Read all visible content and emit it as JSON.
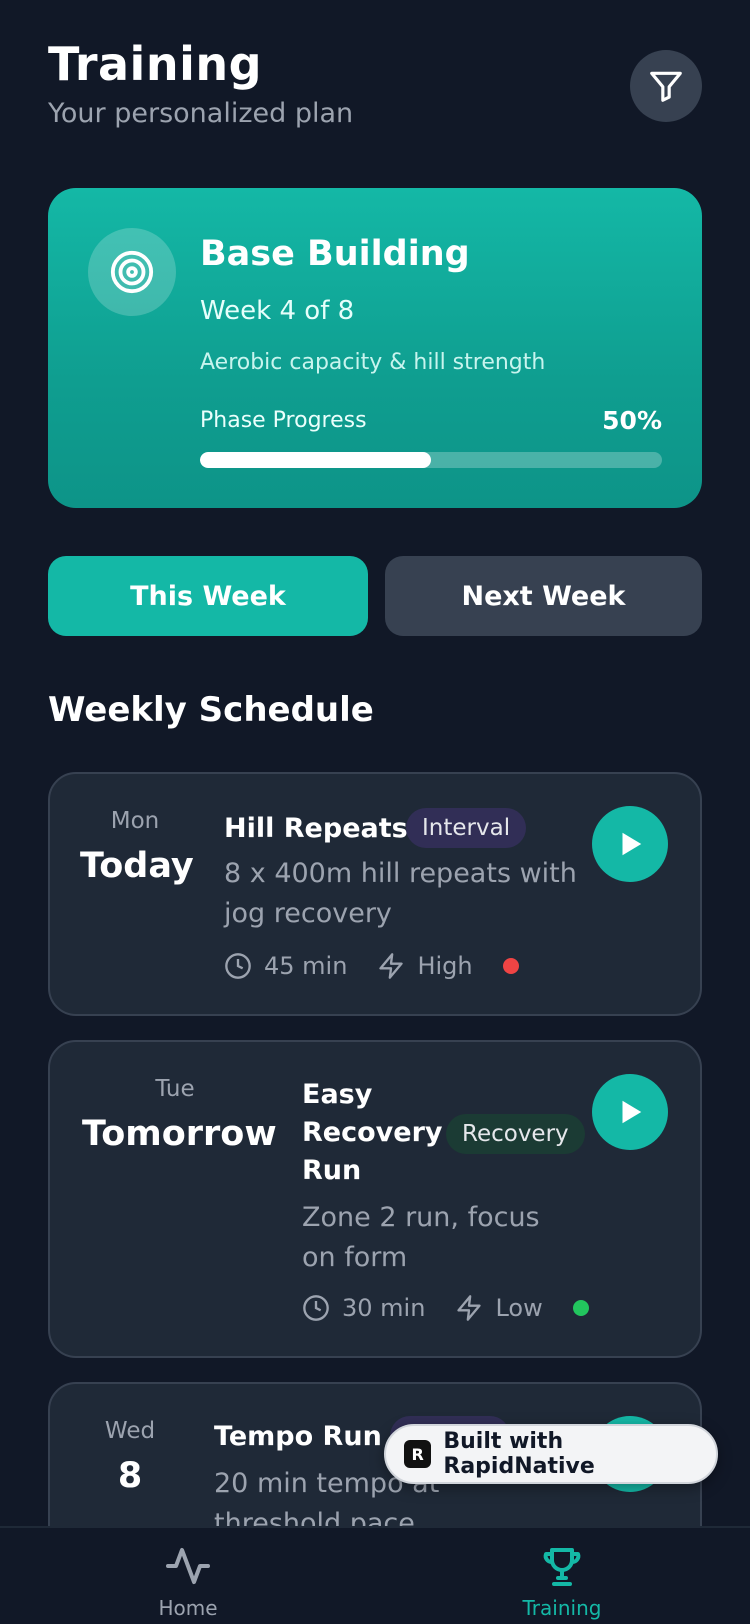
{
  "header": {
    "title": "Training",
    "subtitle": "Your personalized plan",
    "filter_icon": "filter-icon"
  },
  "phase": {
    "icon": "target-icon",
    "name": "Base Building",
    "week": "Week 4 of 8",
    "focus": "Aerobic capacity & hill strength",
    "progress_label": "Phase Progress",
    "progress_text": "50%",
    "progress_fraction": 0.5
  },
  "week_toggle": {
    "this_week": "This Week",
    "next_week": "Next Week",
    "selected": "this_week"
  },
  "schedule": {
    "title": "Weekly Schedule",
    "workouts": [
      {
        "day": "Mon",
        "label": "Today",
        "title": "Hill Repeats",
        "tag": "Interval",
        "description_lines": [
          "8 x 400m hill repeats with",
          "jog recovery"
        ],
        "duration": "45 min",
        "intensity": "High",
        "intensity_color": "#ef4444"
      },
      {
        "day": "Tue",
        "label": "Tomorrow",
        "title_lines": [
          "Easy",
          "Recovery",
          "Run"
        ],
        "tag": "Recovery",
        "description_lines": [
          "Zone 2 run, focus",
          "on form"
        ],
        "duration": "30 min",
        "intensity": "Low",
        "intensity_color": "#22c55e"
      },
      {
        "day": "Wed",
        "label": "8",
        "title": "Tempo Run",
        "description_lines": [
          "20 min tempo at",
          "threshold pace"
        ]
      }
    ]
  },
  "badge": {
    "text": "Built with RapidNative",
    "logo_letter": "R"
  },
  "nav": {
    "home": "Home",
    "training": "Training",
    "active": "training"
  },
  "colors": {
    "background": "#111827",
    "accent": "#14b8a6",
    "card": "#1f2937"
  }
}
